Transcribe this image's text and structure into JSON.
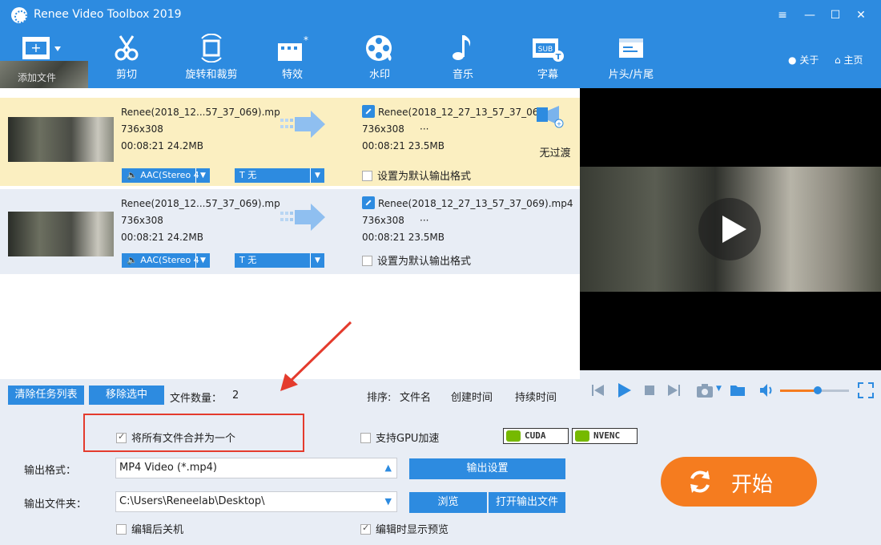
{
  "app": {
    "title": "Renee Video Toolbox 2019"
  },
  "window_controls": {
    "menu": "≡",
    "minimize": "—",
    "maximize": "☐",
    "close": "✕"
  },
  "toolbar": {
    "add_file": "添加文件",
    "cut": "剪切",
    "rotate_crop": "旋转和裁剪",
    "effects": "特效",
    "watermark": "水印",
    "music": "音乐",
    "subtitle": "字幕",
    "intro_outro": "片头/片尾",
    "about": "关于",
    "home": "主页",
    "subtitle_icon_text": "SUB"
  },
  "files": [
    {
      "src_name": "Renee(2018_12...57_37_069).mp",
      "src_res": "736x308",
      "src_duration_size": "00:08:21  24.2MB",
      "dst_name": "Renee(2018_12_27_13_57_37_06",
      "dst_res": "736x308",
      "dst_more": "···",
      "dst_duration_size": "00:08:21  23.5MB",
      "audio": "AAC(Stereo 4",
      "subtitle": "无",
      "default_format": "设置为默认输出格式",
      "transition": "无过渡",
      "selected": true
    },
    {
      "src_name": "Renee(2018_12...57_37_069).mp",
      "src_res": "736x308",
      "src_duration_size": "00:08:21  24.2MB",
      "dst_name": "Renee(2018_12_27_13_57_37_069).mp4",
      "dst_res": "736x308",
      "dst_more": "···",
      "dst_duration_size": "00:08:21  23.5MB",
      "audio": "AAC(Stereo 4",
      "subtitle": "无",
      "default_format": "设置为默认输出格式",
      "selected": false
    }
  ],
  "status": {
    "clear_list": "清除任务列表",
    "remove_selected": "移除选中",
    "file_count_label": "文件数量：",
    "file_count": "2",
    "sort_label": "排序:",
    "sort_by_name": "文件名",
    "sort_by_created": "创建时间",
    "sort_by_duration": "持续时间"
  },
  "player": {
    "volume": 0.55
  },
  "options": {
    "merge_all": "将所有文件合并为一个",
    "gpu_accel": "支持GPU加速",
    "cuda": "CUDA",
    "nvenc": "NVENC",
    "output_format_label": "输出格式：",
    "output_format": "MP4 Video (*.mp4)",
    "output_settings": "输出设置",
    "output_folder_label": "输出文件夹：",
    "output_folder": "C:\\Users\\Reneelab\\Desktop\\",
    "browse": "浏览",
    "open_output": "打开输出文件",
    "shutdown_after": "编辑后关机",
    "show_preview": "编辑时显示预览",
    "start": "开始"
  },
  "colors": {
    "primary": "#2d8be0",
    "accent": "#f57c1f",
    "highlight": "#e43b2d",
    "selected_row": "#fbefc1"
  }
}
